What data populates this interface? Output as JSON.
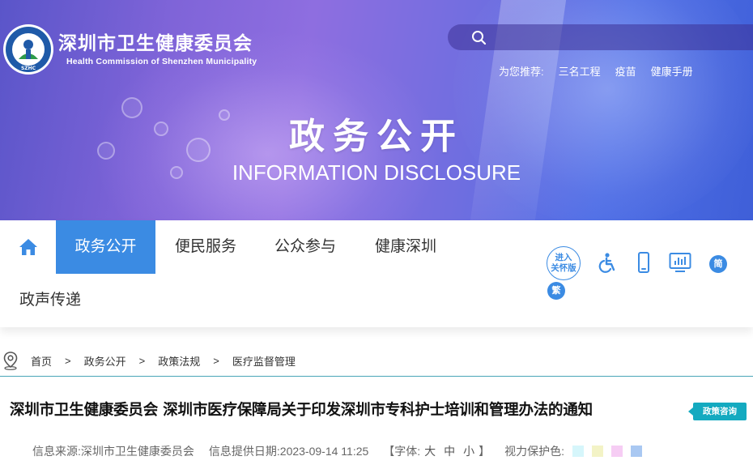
{
  "header": {
    "org_name_cn": "深圳市卫生健康委员会",
    "org_name_en": "Health Commission of Shenzhen Municipality",
    "logo_text": "SZHC",
    "search": {
      "placeholder": "",
      "value": ""
    },
    "recommend": {
      "label": "为您推荐:",
      "links": [
        "三名工程",
        "疫苗",
        "健康手册"
      ]
    }
  },
  "banner": {
    "title_cn": "政务公开",
    "title_en": "INFORMATION DISCLOSURE"
  },
  "nav": {
    "items": [
      "政务公开",
      "便民服务",
      "公众参与",
      "健康深圳",
      "政声传递"
    ],
    "active_index": 0,
    "care_mode": "进入关怀版",
    "care_line1": "进入",
    "care_line2": "关怀版",
    "lang_simplified": "简",
    "lang_traditional": "繁",
    "icons": [
      "home-icon",
      "accessibility-icon",
      "mobile-icon",
      "data-screen-icon"
    ]
  },
  "breadcrumb": {
    "items": [
      "首页",
      "政务公开",
      "政策法规",
      "医疗监督管理"
    ],
    "separator": ">"
  },
  "article": {
    "title": "深圳市卫生健康委员会 深圳市医疗保障局关于印发深圳市专科护士培训和管理办法的通知",
    "consult_badge": "政策咨询",
    "source_label": "信息来源:",
    "source": "深圳市卫生健康委员会",
    "date_label": "信息提供日期:",
    "date": "2023-09-14 11:25",
    "font_label": "【字体:",
    "font_large": "大",
    "font_medium": "中",
    "font_small": "小",
    "font_close": "】",
    "eye_label": "视力保护色:"
  },
  "colors": {
    "accent": "#3b8be3",
    "consult": "#14aac0",
    "swatches": [
      "#d6f6fb",
      "#f3f3c6",
      "#f6cdf4",
      "#a9c8f2"
    ]
  }
}
